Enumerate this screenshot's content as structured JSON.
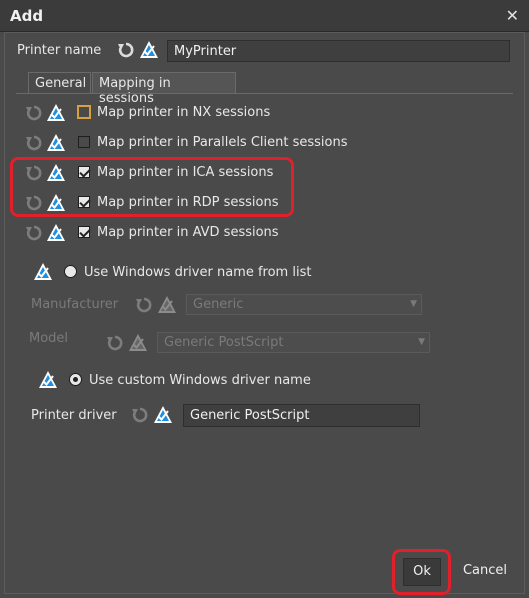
{
  "window": {
    "title": "Add",
    "close_glyph": "✕"
  },
  "printer_name": {
    "label": "Printer name",
    "value": "MyPrinter"
  },
  "tabs": [
    {
      "label": "General",
      "active": false
    },
    {
      "label": "Mapping in sessions",
      "active": true
    }
  ],
  "mapping": [
    {
      "label": "Map printer in NX sessions",
      "checked": false
    },
    {
      "label": "Map printer in Parallels Client sessions",
      "checked": false
    },
    {
      "label": "Map printer in ICA sessions",
      "checked": true
    },
    {
      "label": "Map printer in RDP sessions",
      "checked": true
    },
    {
      "label": "Map printer in AVD sessions",
      "checked": true
    }
  ],
  "driver_options": {
    "from_list_label": "Use Windows driver name from list",
    "manufacturer_label": "Manufacturer",
    "manufacturer_value": "Generic",
    "model_label": "Model",
    "model_value": "Generic PostScript",
    "custom_label": "Use custom Windows driver name",
    "printer_driver_label": "Printer driver",
    "printer_driver_value": "Generic PostScript"
  },
  "buttons": {
    "ok": "Ok",
    "cancel": "Cancel"
  },
  "icons": {
    "reset": "reset-icon",
    "inherit": "inherit-check-icon"
  },
  "colors": {
    "accent_blue": "#1e8fe0",
    "highlight_red": "#e0202a"
  }
}
